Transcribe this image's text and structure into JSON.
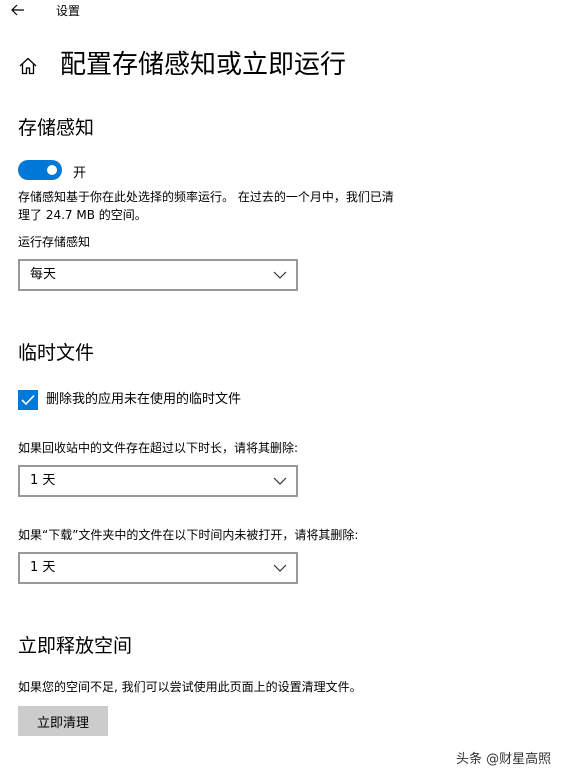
{
  "window": {
    "title": "设置"
  },
  "page": {
    "title": "配置存储感知或立即运行"
  },
  "storage_sense": {
    "heading": "存储感知",
    "toggle_state": "开",
    "description_line1": "存储感知基于你在此处选择的频率运行。 在过去的一个月中，我们已清",
    "description_line2": "理了 24.7 MB 的空间。",
    "run_label": "运行存储感知",
    "run_value": "每天"
  },
  "temp_files": {
    "heading": "临时文件",
    "delete_app_temp_label": "删除我的应用未在使用的临时文件",
    "delete_app_temp_checked": true,
    "recycle_bin_label": "如果回收站中的文件存在超过以下时长，请将其删除:",
    "recycle_bin_value": "1 天",
    "downloads_label": "如果“下载”文件夹中的文件在以下时间内未被打开，请将其删除:",
    "downloads_value": "1 天"
  },
  "free_space": {
    "heading": "立即释放空间",
    "description": "如果您的空间不足, 我们可以尝试使用此页面上的设置清理文件。",
    "clean_button_label": "立即清理"
  },
  "watermark": "头条 @财星高照",
  "colors": {
    "accent": "#0078d7",
    "button_bg": "#cccccc",
    "dropdown_border": "#999999"
  },
  "icons": {
    "back": "back-arrow-icon",
    "home": "home-icon",
    "chevron": "chevron-down-icon",
    "check": "checkmark-icon"
  }
}
